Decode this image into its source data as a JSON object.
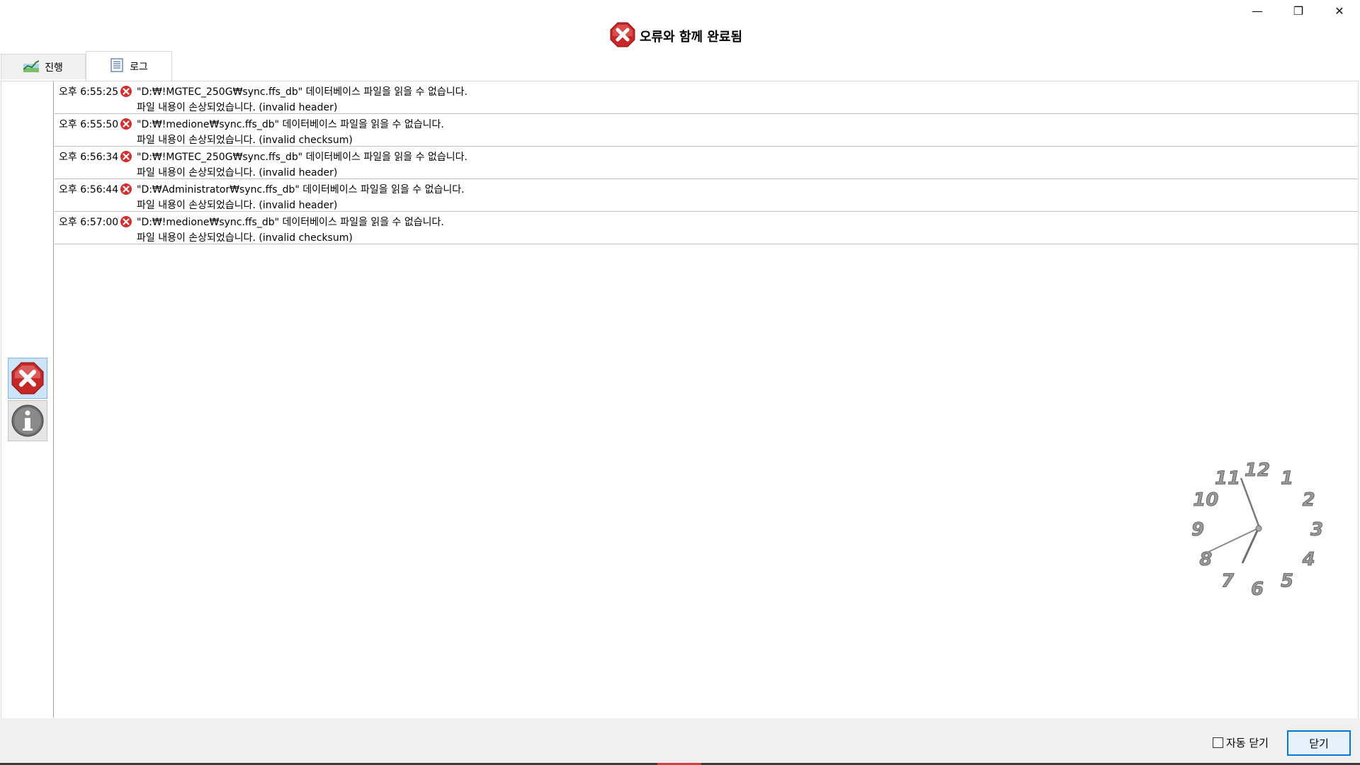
{
  "window": {
    "title": "오류와 함께 완료됨",
    "controls": {
      "minimize": "—",
      "restore": "❐",
      "close": "✕"
    }
  },
  "tabs": [
    {
      "label": "진행",
      "icon": "progress-chart-icon",
      "active": false
    },
    {
      "label": "로그",
      "icon": "log-list-icon",
      "active": true
    }
  ],
  "filters": [
    {
      "name": "error-filter",
      "icon": "error-icon",
      "selected": true
    },
    {
      "name": "info-filter",
      "icon": "info-icon",
      "selected": false
    }
  ],
  "log": [
    {
      "time": "오후 6:55:25",
      "line1": "\"D:₩!MGTEC_250G₩sync.ffs_db\" 데이터베이스 파일을 읽을 수 없습니다.",
      "line2": "파일 내용이 손상되었습니다. (invalid header)"
    },
    {
      "time": "오후 6:55:50",
      "line1": "\"D:₩!medione₩sync.ffs_db\" 데이터베이스 파일을 읽을 수 없습니다.",
      "line2": "파일 내용이 손상되었습니다. (invalid checksum)"
    },
    {
      "time": "오후 6:56:34",
      "line1": "\"D:₩!MGTEC_250G₩sync.ffs_db\" 데이터베이스 파일을 읽을 수 없습니다.",
      "line2": "파일 내용이 손상되었습니다. (invalid header)"
    },
    {
      "time": "오후 6:56:44",
      "line1": "\"D:₩Administrator₩sync.ffs_db\" 데이터베이스 파일을 읽을 수 없습니다.",
      "line2": "파일 내용이 손상되었습니다. (invalid header)"
    },
    {
      "time": "오후 6:57:00",
      "line1": "\"D:₩!medione₩sync.ffs_db\" 데이터베이스 파일을 읽을 수 없습니다.",
      "line2": "파일 내용이 손상되었습니다. (invalid checksum)"
    }
  ],
  "clock": {
    "numbers": [
      "12",
      "1",
      "2",
      "3",
      "4",
      "5",
      "6",
      "7",
      "8",
      "9",
      "10",
      "11"
    ],
    "time": "6:57"
  },
  "footer": {
    "auto_close_label": "자동 닫기",
    "auto_close_checked": false,
    "close_button": "닫기"
  },
  "colors": {
    "error_red": "#d32f2f",
    "accent_blue": "#0078d7"
  }
}
